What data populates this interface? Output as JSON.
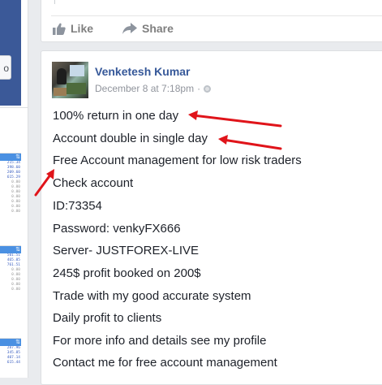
{
  "previous_post": {
    "actions": [
      {
        "label": "Like",
        "icon": "thumbs-up-icon"
      },
      {
        "label": "Share",
        "icon": "share-arrow-icon"
      }
    ]
  },
  "post": {
    "author": "Venketesh Kumar",
    "timestamp": "December 8 at 7:18pm",
    "separator": "·",
    "privacy_icon": "globe-icon",
    "lines": [
      "100% return in one day",
      "Account double in single day",
      "Free Account management for low risk traders",
      "Check account",
      "ID:73354",
      "Password: venkyFX666",
      "Server- JUSTFOREX-LIVE",
      "245$ profit booked on 200$",
      "Trade with my good accurate system",
      "Daily profit to clients",
      "For more info and details see my profile",
      "Contact me for free account management"
    ],
    "annotation_color": "#e0141a"
  },
  "left_column": {
    "button_label": "o",
    "panels": [
      {
        "head_icon": "⇅",
        "rows": [
          "215.34",
          "398.60",
          "209.60",
          "615.29",
          "",
          "",
          "0.00",
          "0.00",
          "0.00",
          "0.00",
          "0.00",
          "0.00",
          "0.00"
        ]
      },
      {
        "head_icon": "⇅",
        "rows": [
          "501.51",
          "465.05",
          "761.51",
          "",
          "0.00",
          "0.00",
          "0.00",
          "0.00",
          "0.00"
        ]
      },
      {
        "head_icon": "⇅",
        "rows": [
          "287.96",
          "345.85",
          "407.14",
          "615.44"
        ]
      }
    ]
  }
}
